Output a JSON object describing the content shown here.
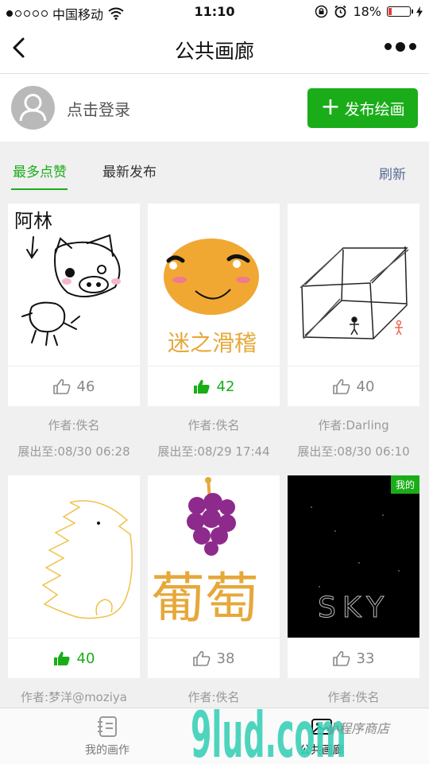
{
  "status": {
    "carrier": "中国移动",
    "time": "11:10",
    "battery": "18%",
    "battery_level": 0.18
  },
  "nav": {
    "title": "公共画廊"
  },
  "user": {
    "login_label": "点击登录",
    "publish_label": "发布绘画"
  },
  "tabs": [
    {
      "label": "最多点赞",
      "active": true
    },
    {
      "label": "最新发布",
      "active": false
    }
  ],
  "refresh_label": "刷新",
  "cards": [
    {
      "likes": "46",
      "liked": false,
      "author": "作者:佚名",
      "expires": "展出至:08/30 06:28",
      "art_text": "阿林"
    },
    {
      "likes": "42",
      "liked": true,
      "author": "作者:佚名",
      "expires": "展出至:08/29 17:44",
      "art_text": "迷之滑稽"
    },
    {
      "likes": "40",
      "liked": false,
      "author": "作者:Darling",
      "expires": "展出至:08/30 06:10"
    },
    {
      "likes": "40",
      "liked": true,
      "author": "作者:梦洋@moziya"
    },
    {
      "likes": "38",
      "liked": false,
      "author": "作者:佚名",
      "art_text": "葡萄"
    },
    {
      "likes": "33",
      "liked": false,
      "author": "作者:佚名",
      "badge": "我的",
      "art_text": "SKY"
    }
  ],
  "tabbar": [
    {
      "label": "我的画作"
    },
    {
      "label": "公共画廊"
    }
  ],
  "colors": {
    "accent": "#1aad19",
    "link": "#576b95",
    "background": "#f0f0f0"
  },
  "watermark": {
    "text": "9lud.com",
    "tagline": "小程序商店"
  }
}
